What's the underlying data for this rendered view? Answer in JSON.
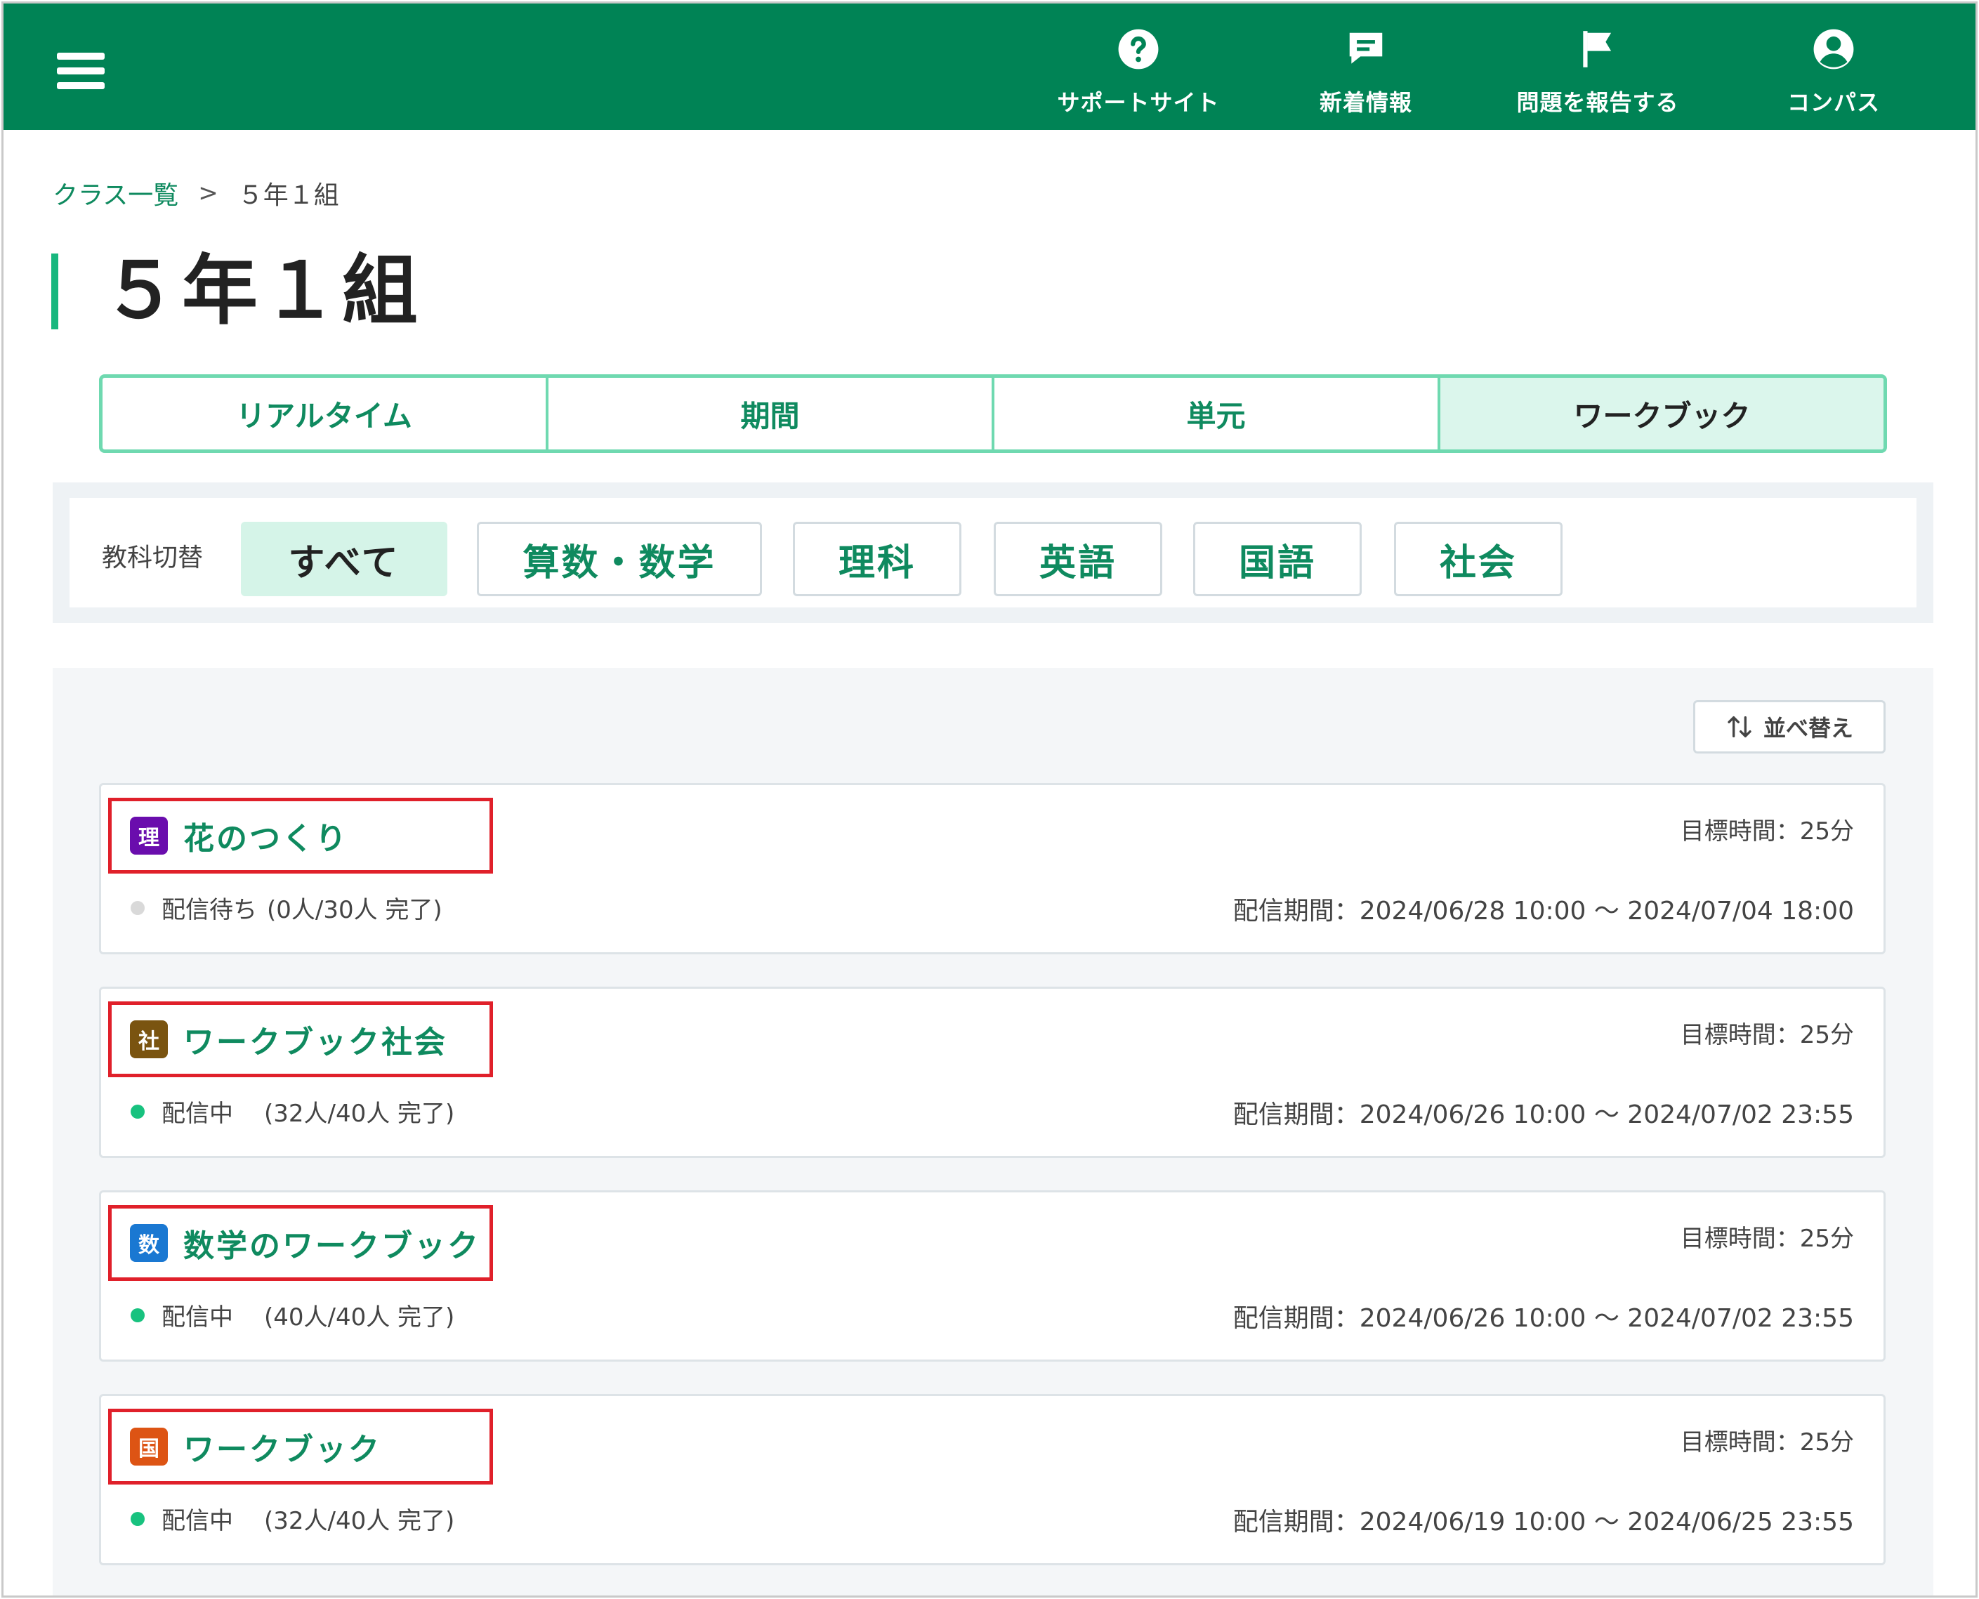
{
  "header": {
    "nav": [
      {
        "label": "サポートサイト",
        "icon": "question-circle-icon"
      },
      {
        "label": "新着情報",
        "icon": "message-icon"
      },
      {
        "label": "問題を報告する",
        "icon": "flag-icon"
      },
      {
        "label": "コンパス",
        "icon": "user-circle-icon"
      }
    ],
    "color": "#008355"
  },
  "breadcrumb": {
    "parent": "クラス一覧",
    "separator": ">",
    "current": "５年１組"
  },
  "page": {
    "title": "５年１組"
  },
  "view_tabs": [
    {
      "label": "リアルタイム",
      "active": false
    },
    {
      "label": "期間",
      "active": false
    },
    {
      "label": "単元",
      "active": false
    },
    {
      "label": "ワークブック",
      "active": true
    }
  ],
  "subject_filter": {
    "label": "教科切替",
    "options": [
      {
        "label": "すべて",
        "active": true
      },
      {
        "label": "算数・数学",
        "active": false
      },
      {
        "label": "理科",
        "active": false
      },
      {
        "label": "英語",
        "active": false
      },
      {
        "label": "国語",
        "active": false
      },
      {
        "label": "社会",
        "active": false
      }
    ]
  },
  "list": {
    "sort_label": "並べ替え",
    "workbooks": [
      {
        "subject_badge": "理",
        "badge_color": "#6a0dad",
        "title": "花のつくり",
        "target_time": "目標時間：25分",
        "status": "配信待ち",
        "status_color": "#d9d9d9",
        "progress": "(0人/30人 完了)",
        "period": "配信期間：2024/06/28 10:00 ～ 2024/07/04 18:00"
      },
      {
        "subject_badge": "社",
        "badge_color": "#7a5410",
        "title": "ワークブック社会",
        "target_time": "目標時間：25分",
        "status": "配信中",
        "status_color": "#18c27f",
        "progress": "(32人/40人 完了)",
        "period": "配信期間：2024/06/26 10:00 ～ 2024/07/02 23:55"
      },
      {
        "subject_badge": "数",
        "badge_color": "#1a78d2",
        "title": "数学のワークブック",
        "target_time": "目標時間：25分",
        "status": "配信中",
        "status_color": "#18c27f",
        "progress": "(40人/40人 完了)",
        "period": "配信期間：2024/06/26 10:00 ～ 2024/07/02 23:55"
      },
      {
        "subject_badge": "国",
        "badge_color": "#dd5414",
        "title": "ワークブック",
        "target_time": "目標時間：25分",
        "status": "配信中",
        "status_color": "#18c27f",
        "progress": "(32人/40人 完了)",
        "period": "配信期間：2024/06/19 10:00 ～ 2024/06/25 23:55"
      }
    ]
  }
}
